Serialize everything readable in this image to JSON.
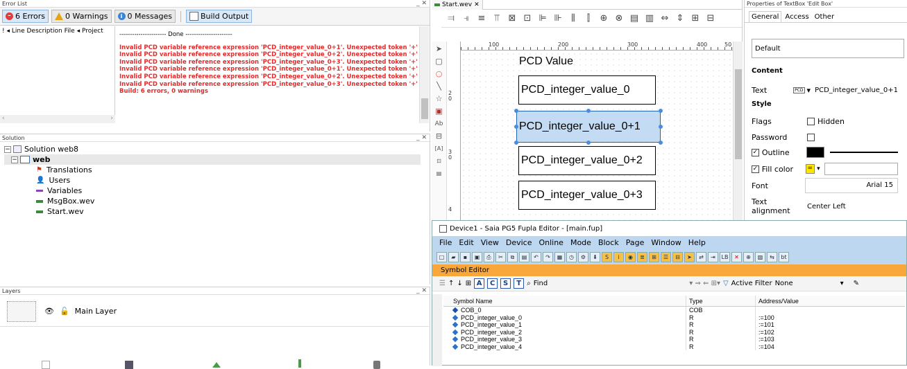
{
  "error_list": {
    "title": "Error List",
    "errors_btn": "6 Errors",
    "warnings_btn": "0 Warnings",
    "messages_btn": "0 Messages",
    "build_output_btn": "Build Output",
    "columns": [
      "Line",
      "Description",
      "File",
      "Project"
    ],
    "done_line": "---------------------- Done ----------------------",
    "messages": [
      "Invalid PCD variable reference expression 'PCD_integer_value_0+1'. Unexpected token '+'",
      "Invalid PCD variable reference expression 'PCD_integer_value_0+2'. Unexpected token '+'",
      "Invalid PCD variable reference expression 'PCD_integer_value_0+3'. Unexpected token '+'",
      "Invalid PCD variable reference expression 'PCD_integer_value_0+1'. Unexpected token '+'",
      "Invalid PCD variable reference expression 'PCD_integer_value_0+2'. Unexpected token '+'",
      "Invalid PCD variable reference expression 'PCD_integer_value_0+3'. Unexpected token '+'"
    ],
    "summary": "Build: 6 errors, 0 warnings"
  },
  "solution": {
    "title": "Solution",
    "root": "Solution web8",
    "project": "web",
    "items": [
      "Translations",
      "Users",
      "Variables",
      "MsgBox.wev",
      "Start.wev"
    ]
  },
  "layers": {
    "title": "Layers",
    "main_layer": "Main Layer"
  },
  "editor": {
    "tab": "Start.wev",
    "ruler_marks": [
      "100",
      "200",
      "300",
      "400",
      "50"
    ],
    "heading": "PCD Value",
    "boxes": [
      "PCD_integer_value_0",
      "PCD_integer_value_0+1",
      "PCD_integer_value_0+2",
      "PCD_integer_value_0+3"
    ]
  },
  "properties": {
    "title": "Properties of TextBox 'Edit Box'",
    "tabs": [
      "General",
      "Access",
      "Other"
    ],
    "default_value": "Default",
    "section_content": "Content",
    "text_label": "Text",
    "text_value": "PCD_integer_value_0+1",
    "section_style": "Style",
    "flags_label": "Flags",
    "hidden_label": "Hidden",
    "password_label": "Password",
    "outline_label": "Outline",
    "fill_label": "Fill color",
    "font_label": "Font",
    "font_value": "Arial 15",
    "align_label": "Text alignment",
    "align_value": "Center Left"
  },
  "fupla": {
    "title": "Device1 - Saia PG5 Fupla Editor - [main.fup]",
    "menu": [
      "File",
      "Edit",
      "View",
      "Device",
      "Online",
      "Mode",
      "Block",
      "Page",
      "Window",
      "Help"
    ],
    "symbol_editor": "Symbol Editor",
    "find_label": "Find",
    "active_filter_label": "Active Filter",
    "filter_value": "None",
    "headers": [
      "Symbol Name",
      "Type",
      "Address/Value"
    ],
    "rows": [
      {
        "name": "COB_0",
        "type": "COB",
        "addr": ""
      },
      {
        "name": "PCD_integer_value_0",
        "type": "R",
        "addr": ":=100"
      },
      {
        "name": "PCD_integer_value_1",
        "type": "R",
        "addr": ":=101"
      },
      {
        "name": "PCD_integer_value_2",
        "type": "R",
        "addr": ":=102"
      },
      {
        "name": "PCD_integer_value_3",
        "type": "R",
        "addr": ":=103"
      },
      {
        "name": "PCD_integer_value_4",
        "type": "R",
        "addr": ":=104"
      }
    ]
  },
  "colors": {
    "error_red": "#e32b2b",
    "selection": "#c3dbf3",
    "fupla_bar": "#bdd7f0",
    "symbol_bar": "#f9a63a"
  }
}
